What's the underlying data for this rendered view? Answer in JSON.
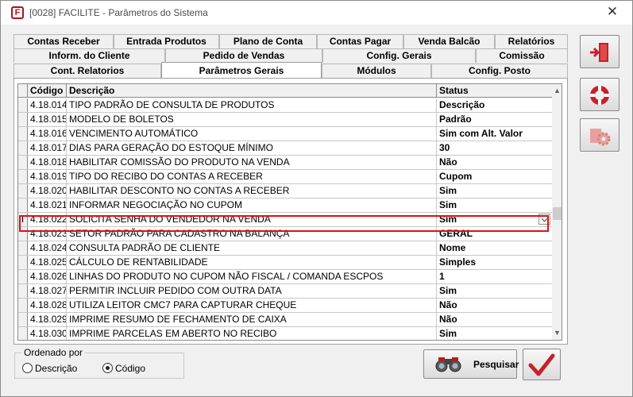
{
  "window": {
    "title": "[0028] FACILITE - Parâmetros do Sistema",
    "app_icon_letter": "F",
    "close_glyph": "✕"
  },
  "tabs": {
    "row1": [
      "Contas Receber",
      "Entrada Produtos",
      "Plano de Conta",
      "Contas Pagar",
      "Venda Balcão",
      "Relatórios"
    ],
    "row2": [
      "Inform. do Cliente",
      "Pedido de Vendas",
      "Config. Gerais",
      "Comissão"
    ],
    "row3": [
      "Cont. Relatorios",
      "Parâmetros Gerais",
      "Módulos",
      "Config. Posto"
    ],
    "active": "Parâmetros Gerais"
  },
  "grid": {
    "columns": [
      "Código",
      "Descrição",
      "Status"
    ],
    "rows": [
      {
        "code": "4.18.014",
        "desc": "TIPO PADRÃO DE CONSULTA DE PRODUTOS",
        "status": "Descrição"
      },
      {
        "code": "4.18.015",
        "desc": "MODELO DE BOLETOS",
        "status": "Padrão"
      },
      {
        "code": "4.18.016",
        "desc": "VENCIMENTO AUTOMÁTICO",
        "status": "Sim com Alt. Valor"
      },
      {
        "code": "4.18.017",
        "desc": "DIAS PARA GERAÇÃO DO ESTOQUE MÍNIMO",
        "status": "30"
      },
      {
        "code": "4.18.018",
        "desc": "HABILITAR COMISSÃO DO PRODUTO NA VENDA",
        "status": "Não"
      },
      {
        "code": "4.18.019",
        "desc": "TIPO DO RECIBO DO CONTAS A RECEBER",
        "status": "Cupom"
      },
      {
        "code": "4.18.020",
        "desc": "HABILITAR DESCONTO NO CONTAS A RECEBER",
        "status": "Sim"
      },
      {
        "code": "4.18.021",
        "desc": "INFORMAR NEGOCIAÇÃO NO CUPOM",
        "status": "Sim"
      },
      {
        "code": "4.18.022",
        "desc": "SOLICITA SENHA DO VENDEDOR NA VENDA",
        "status": "Sim"
      },
      {
        "code": "4.18.023",
        "desc": "SETOR PADRÃO PARA CADASTRO NA BALANÇA",
        "status": "GERAL"
      },
      {
        "code": "4.18.024",
        "desc": "CONSULTA PADRÃO DE CLIENTE",
        "status": "Nome"
      },
      {
        "code": "4.18.025",
        "desc": "CÁLCULO DE RENTABILIDADE",
        "status": "Simples"
      },
      {
        "code": "4.18.026",
        "desc": "LINHAS DO PRODUTO NO CUPOM NÃO FISCAL / COMANDA ESCPOS",
        "status": "1"
      },
      {
        "code": "4.18.027",
        "desc": "PERMITIR INCLUIR PEDIDO COM OUTRA DATA",
        "status": "Sim"
      },
      {
        "code": "4.18.028",
        "desc": "UTILIZA LEITOR CMC7 PARA CAPTURAR CHEQUE",
        "status": "Não"
      },
      {
        "code": "4.18.029",
        "desc": "IMPRIME RESUMO DE FECHAMENTO DE CAIXA",
        "status": "Não"
      },
      {
        "code": "4.18.030",
        "desc": "IMPRIME PARCELAS EM ABERTO NO RECIBO",
        "status": "Sim"
      }
    ],
    "selected_index": 8,
    "edit_cursor": "I",
    "dropdown_glyph": "⌵"
  },
  "order": {
    "legend": "Ordenado por",
    "options": [
      "Descrição",
      "Código"
    ],
    "selected": "Código"
  },
  "buttons": {
    "search_label": "Pesquisar"
  },
  "colors": {
    "highlight": "#e01010",
    "accent_red": "#c8202a"
  }
}
